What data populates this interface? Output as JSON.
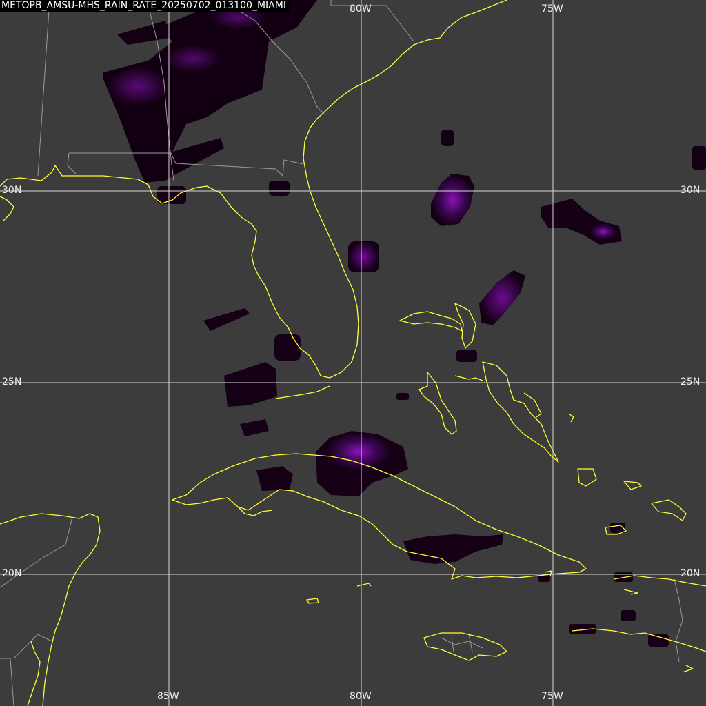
{
  "title": "METOPB_AMSU-MHS_RAIN_RATE_20250702_013100_MIAMI",
  "colors": {
    "background": "#3c3c3c",
    "coastline": "#ffff33",
    "borders": "#9a9a9a",
    "gridlines": "#d8d8d8",
    "rain_low": "#0e000e",
    "rain_high": "#9b10c8",
    "text": "#ffffff"
  },
  "grid": {
    "longitudes": [
      {
        "label": "85W",
        "value": -85
      },
      {
        "label": "80W",
        "value": -80
      },
      {
        "label": "75W",
        "value": -75
      }
    ],
    "latitudes": [
      {
        "label": "30N",
        "value": 30
      },
      {
        "label": "25N",
        "value": 25
      },
      {
        "label": "20N",
        "value": 20
      }
    ]
  },
  "labels": {
    "top_lon": [
      "80W",
      "75W"
    ],
    "bottom_lon": [
      "85W",
      "80W",
      "75W"
    ],
    "left_lat": [
      "30N",
      "25N",
      "20N"
    ],
    "right_lat": [
      "30N",
      "25N",
      "20N"
    ]
  }
}
